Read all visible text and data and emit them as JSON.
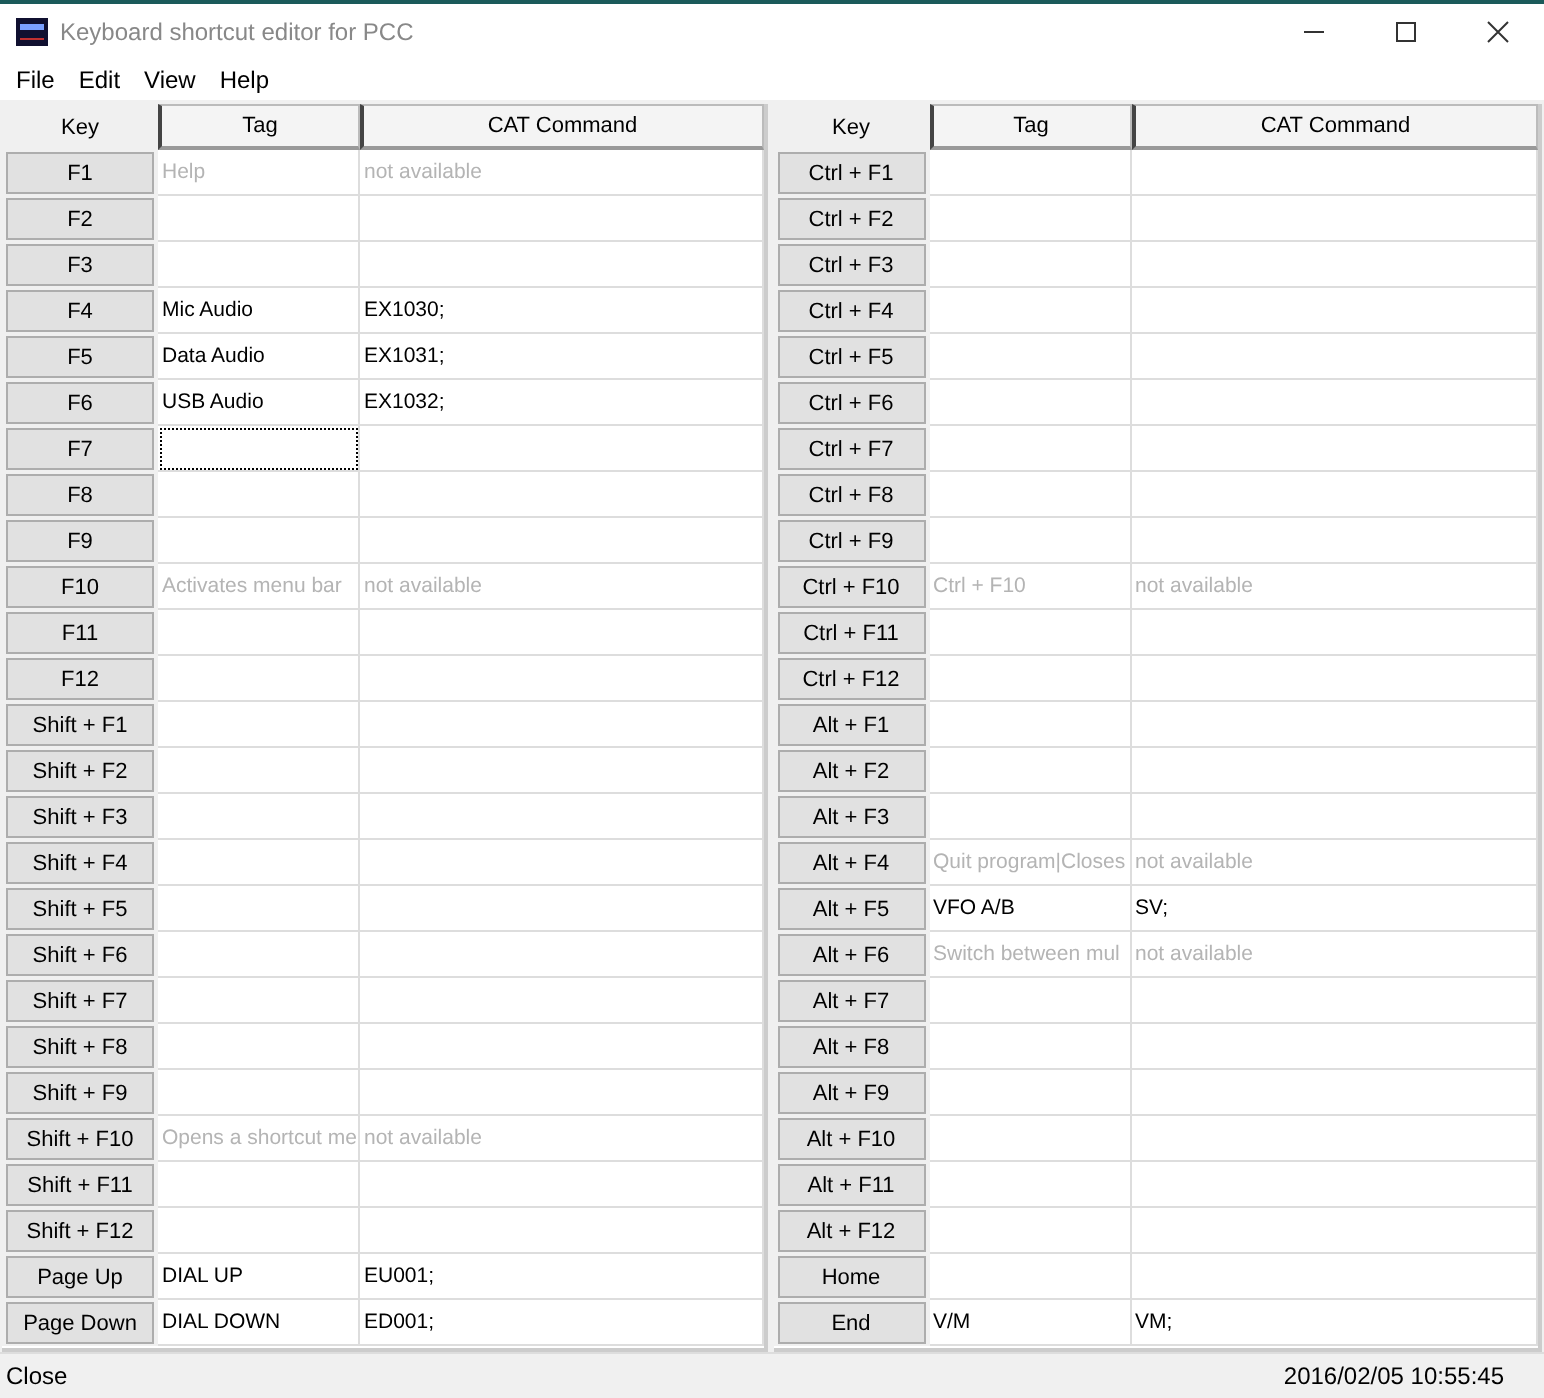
{
  "window": {
    "title": "Keyboard shortcut editor for PCC"
  },
  "menu": [
    "File",
    "Edit",
    "View",
    "Help"
  ],
  "panels": [
    {
      "columns": [
        "Key",
        "Tag",
        "CAT Command"
      ],
      "rows": [
        {
          "key": "F1",
          "tag": "Help",
          "command": "not available",
          "dimmed": true,
          "focused": false
        },
        {
          "key": "F2",
          "focused": false
        },
        {
          "key": "F3",
          "focused": false
        },
        {
          "key": "F4",
          "tag": "Mic Audio",
          "command": "EX1030;",
          "dimmed": false,
          "focused": false
        },
        {
          "key": "F5",
          "tag": "Data Audio",
          "command": "EX1031;",
          "dimmed": false,
          "focused": false
        },
        {
          "key": "F6",
          "tag": "USB Audio",
          "command": "EX1032;",
          "dimmed": false,
          "focused": false
        },
        {
          "key": "F7",
          "focused": true
        },
        {
          "key": "F8",
          "focused": false
        },
        {
          "key": "F9",
          "focused": false
        },
        {
          "key": "F10",
          "tag": "Activates menu bar",
          "command": "not available",
          "dimmed": true,
          "focused": false
        },
        {
          "key": "F11",
          "focused": false
        },
        {
          "key": "F12",
          "focused": false
        },
        {
          "key": "Shift + F1",
          "focused": false
        },
        {
          "key": "Shift + F2",
          "focused": false
        },
        {
          "key": "Shift + F3",
          "focused": false
        },
        {
          "key": "Shift + F4",
          "focused": false
        },
        {
          "key": "Shift + F5",
          "focused": false
        },
        {
          "key": "Shift + F6",
          "focused": false
        },
        {
          "key": "Shift + F7",
          "focused": false
        },
        {
          "key": "Shift + F8",
          "focused": false
        },
        {
          "key": "Shift + F9",
          "focused": false
        },
        {
          "key": "Shift + F10",
          "tag": "Opens a shortcut me",
          "command": "not available",
          "dimmed": true,
          "focused": false
        },
        {
          "key": "Shift + F11",
          "focused": false
        },
        {
          "key": "Shift + F12",
          "focused": false
        },
        {
          "key": "Page Up",
          "tag": "DIAL UP",
          "command": "EU001;",
          "dimmed": false,
          "focused": false
        },
        {
          "key": "Page Down",
          "tag": "DIAL DOWN",
          "command": "ED001;",
          "dimmed": false,
          "focused": false
        }
      ]
    },
    {
      "columns": [
        "Key",
        "Tag",
        "CAT Command"
      ],
      "rows": [
        {
          "key": "Ctrl + F1",
          "focused": false
        },
        {
          "key": "Ctrl + F2",
          "focused": false
        },
        {
          "key": "Ctrl + F3",
          "focused": false
        },
        {
          "key": "Ctrl + F4",
          "focused": false
        },
        {
          "key": "Ctrl + F5",
          "focused": false
        },
        {
          "key": "Ctrl + F6",
          "focused": false
        },
        {
          "key": "Ctrl + F7",
          "focused": false
        },
        {
          "key": "Ctrl + F8",
          "focused": false
        },
        {
          "key": "Ctrl + F9",
          "focused": false
        },
        {
          "key": "Ctrl + F10",
          "tag": "Ctrl + F10",
          "command": "not available",
          "dimmed": true,
          "focused": false
        },
        {
          "key": "Ctrl + F11",
          "focused": false
        },
        {
          "key": "Ctrl + F12",
          "focused": false
        },
        {
          "key": "Alt + F1",
          "focused": false
        },
        {
          "key": "Alt + F2",
          "focused": false
        },
        {
          "key": "Alt + F3",
          "focused": false
        },
        {
          "key": "Alt + F4",
          "tag": "Quit program|Closes",
          "command": "not available",
          "dimmed": true,
          "focused": false
        },
        {
          "key": "Alt + F5",
          "tag": "VFO A/B",
          "command": "SV;",
          "dimmed": false,
          "focused": false
        },
        {
          "key": "Alt + F6",
          "tag": "Switch between mul",
          "command": "not available",
          "dimmed": true,
          "focused": false
        },
        {
          "key": "Alt + F7",
          "focused": false
        },
        {
          "key": "Alt + F8",
          "focused": false
        },
        {
          "key": "Alt + F9",
          "focused": false
        },
        {
          "key": "Alt + F10",
          "focused": false
        },
        {
          "key": "Alt + F11",
          "focused": false
        },
        {
          "key": "Alt + F12",
          "focused": false
        },
        {
          "key": "Home",
          "focused": false
        },
        {
          "key": "End",
          "tag": "V/M",
          "command": "VM;",
          "dimmed": false,
          "focused": false
        }
      ]
    }
  ],
  "status_bar": {
    "message": "Close",
    "time": "2016/02/05 10:55:45"
  }
}
